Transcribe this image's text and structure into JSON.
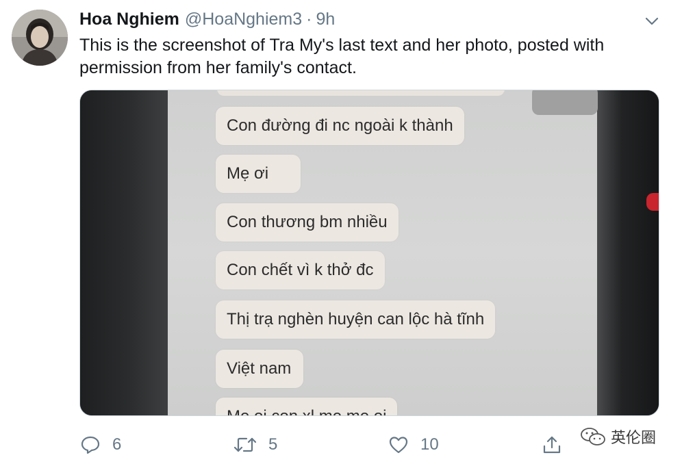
{
  "tweet": {
    "author_name": "Hoa Nghiem",
    "handle": "@HoaNghiem3",
    "separator": "·",
    "time": "9h",
    "text": "This is the screenshot of Tra My's last text and her photo, posted with permission from her family's contact."
  },
  "media": {
    "messages": [
      "Con đường đi nc ngoài k thành",
      "Mẹ ơi",
      "Con thương bm nhiều",
      "Con chết vì k thở đc",
      "Thị trạ nghèn huyện can lộc hà tĩnh",
      "Việt nam",
      "Me oi con xl me me oi"
    ]
  },
  "actions": {
    "reply_count": "6",
    "retweet_count": "5",
    "like_count": "10"
  },
  "watermark": {
    "text": "英伦圈"
  },
  "icons": {
    "reply": "reply-icon",
    "retweet": "retweet-icon",
    "like": "heart-icon",
    "share": "share-icon",
    "caret": "chevron-down-icon",
    "watermark": "wechat-icon"
  },
  "colors": {
    "text_primary": "#14171a",
    "text_secondary": "#657786",
    "bubble": "#ece7e1"
  }
}
